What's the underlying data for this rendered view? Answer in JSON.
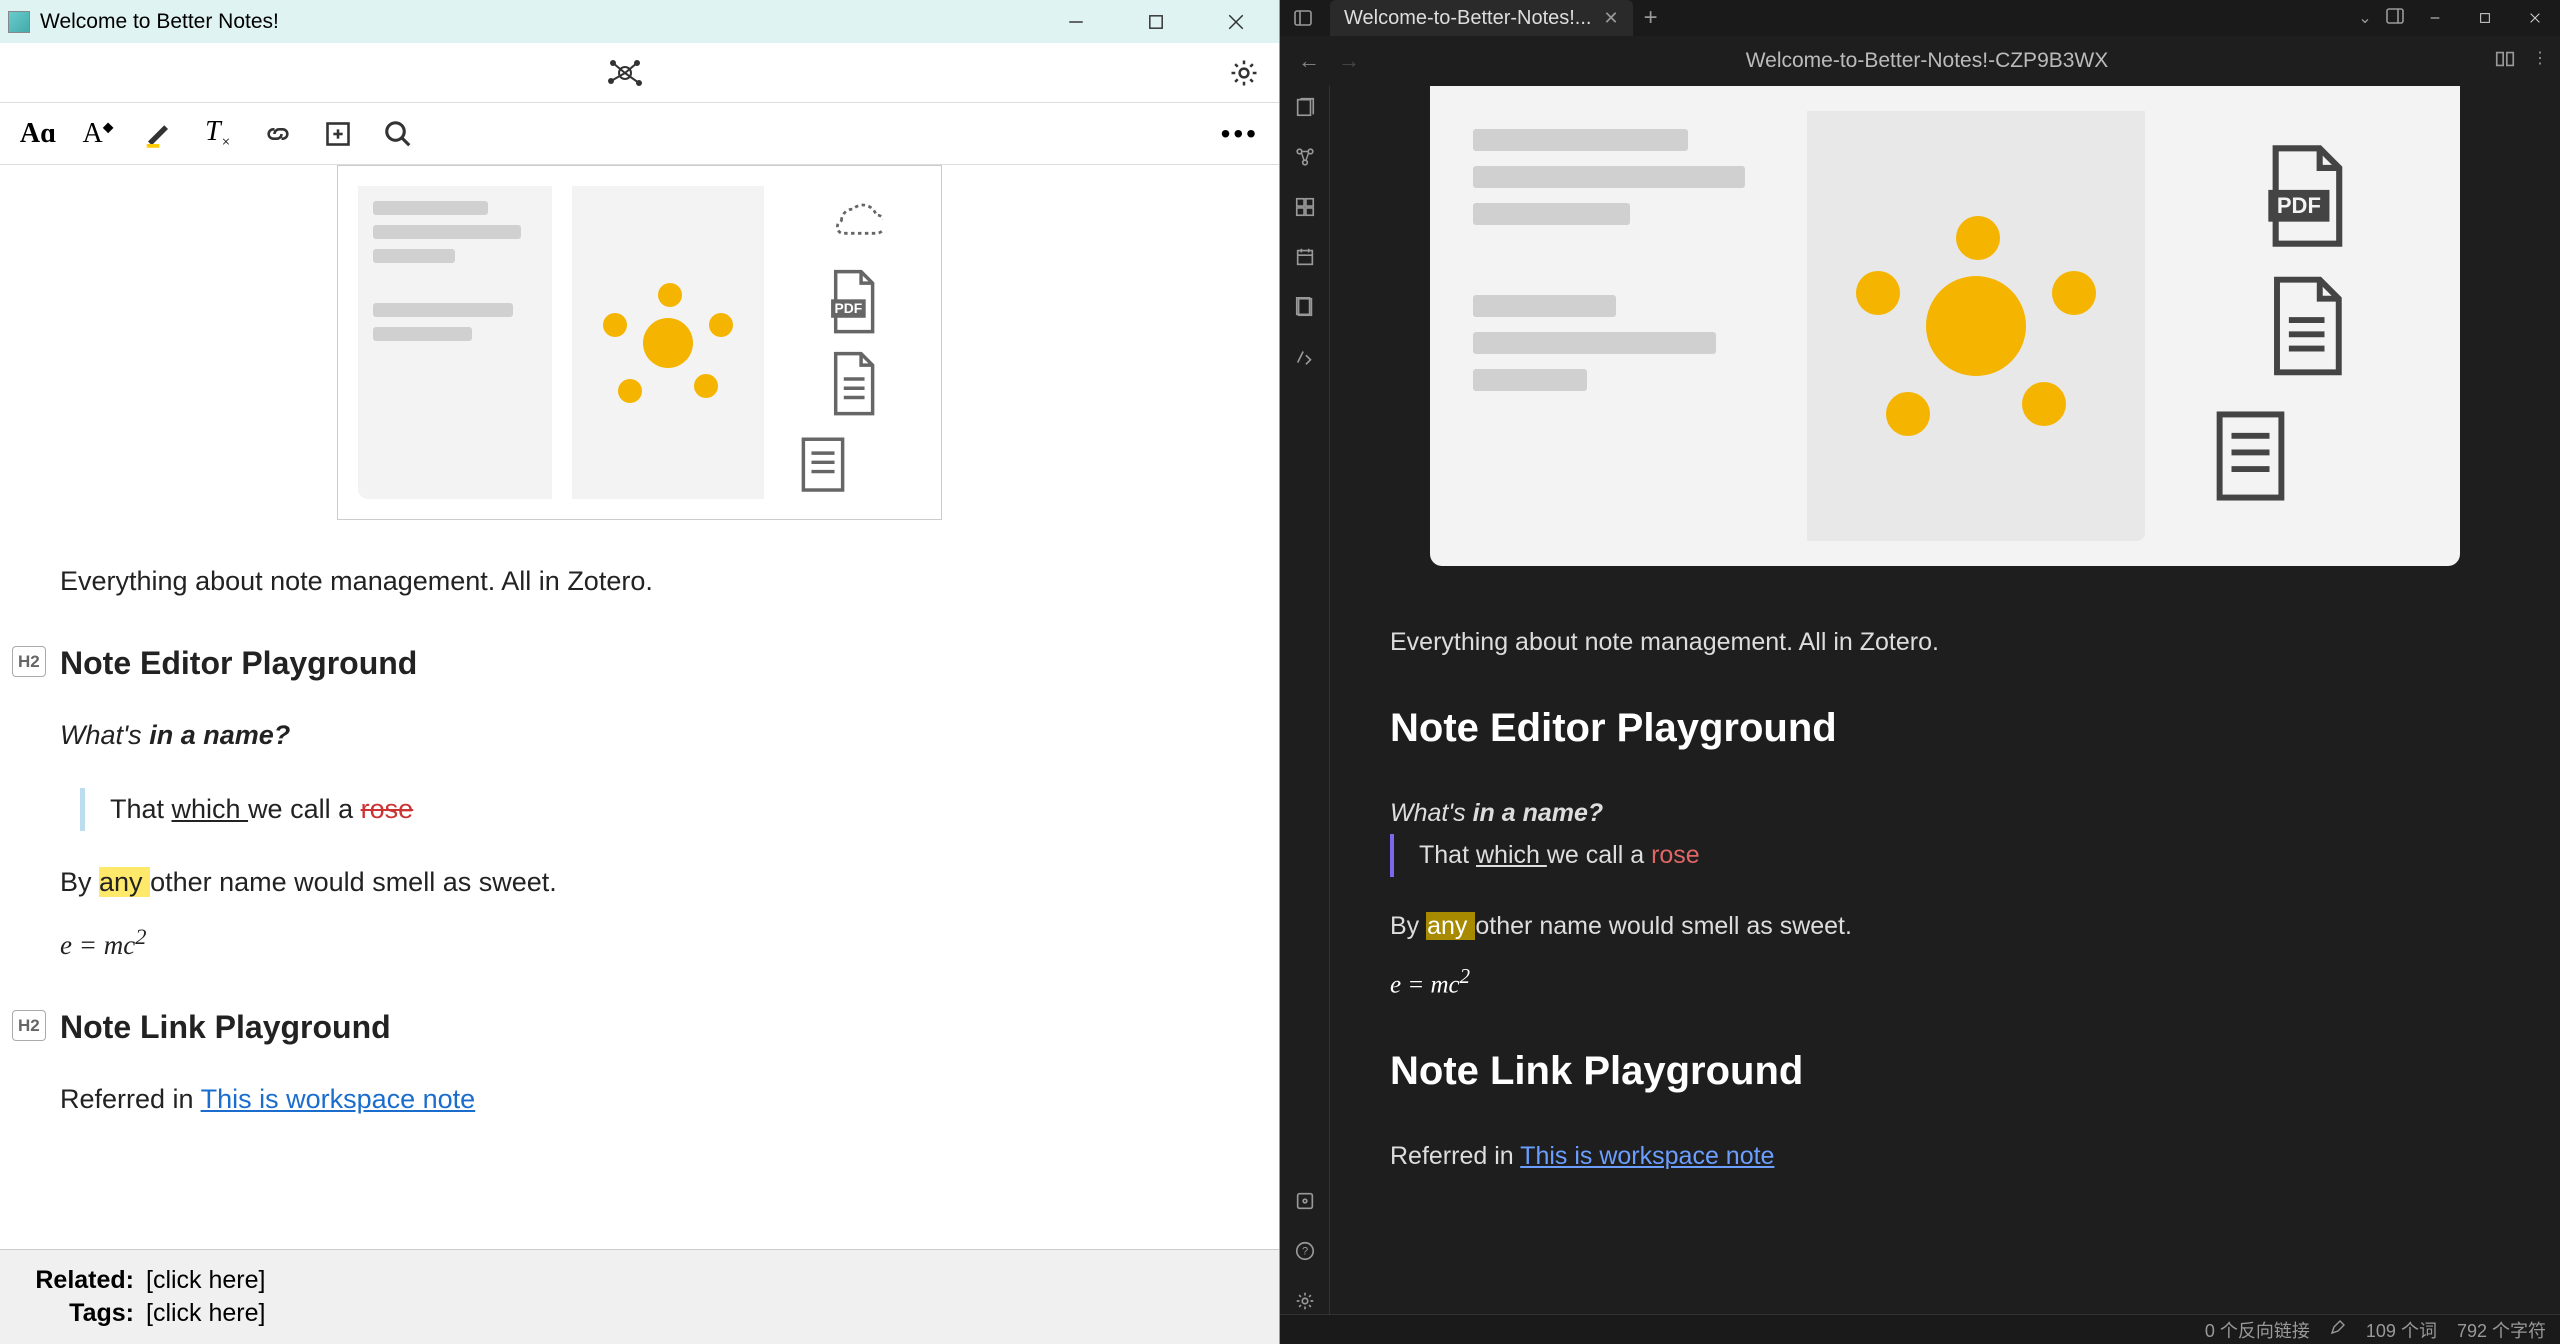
{
  "left": {
    "title": "Welcome to Better Notes!",
    "toolbar": {
      "font": "Aɑ",
      "style": "A",
      "highlight": "✎",
      "clear": "T",
      "link": "🔗",
      "insert": "[+]",
      "search": "⌕",
      "more": "•••"
    },
    "para1": "Everything about note management. All in Zotero.",
    "h2a": "Note Editor Playground",
    "whats": "What's",
    "inaname": "in a name?",
    "quote_pre": "That ",
    "quote_u": "which ",
    "quote_mid": "we call a ",
    "quote_rose": "rose",
    "by": "By ",
    "any": "any ",
    "rest": "other name would smell as sweet.",
    "eq": "e = mc",
    "eqsup": "2",
    "h2b": "Note Link Playground",
    "ref_pre": "Referred in ",
    "ref_link": "This is workspace note",
    "related_label": "Related:",
    "related_val": "[click here]",
    "tags_label": "Tags:",
    "tags_val": "[click here]"
  },
  "right": {
    "tab": "Welcome-to-Better-Notes!...",
    "crumb": "Welcome-to-Better-Notes!-CZP9B3WX",
    "para1": "Everything about note management. All in Zotero.",
    "h2a": "Note Editor Playground",
    "whats": "What's",
    "inaname": "in a name?",
    "quote_pre": "That ",
    "quote_u": "which ",
    "quote_mid": "we call a ",
    "quote_rose": "rose",
    "by": "By ",
    "any": "any ",
    "rest": "other name would smell as sweet.",
    "eq": "e = mc",
    "eqsup": "2",
    "h2b": "Note Link Playground",
    "ref_pre": "Referred in ",
    "ref_link": "This is workspace note",
    "status_backlinks": "0 个反向链接",
    "status_words": "109 个词",
    "status_chars": "792 个字符",
    "pdf_label": "PDF"
  }
}
